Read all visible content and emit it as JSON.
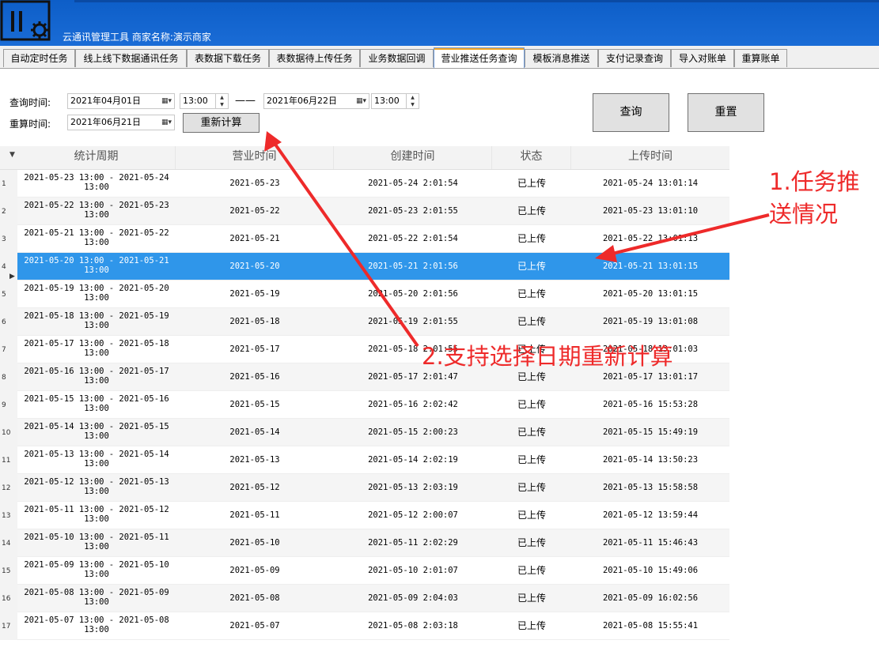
{
  "app": {
    "title": "云通讯管理工具  商家名称:演示商家"
  },
  "tabs": [
    {
      "label": "自动定时任务"
    },
    {
      "label": "线上线下数据通讯任务"
    },
    {
      "label": "表数据下载任务"
    },
    {
      "label": "表数据待上传任务"
    },
    {
      "label": "业务数据回调"
    },
    {
      "label": "营业推送任务查询"
    },
    {
      "label": "模板消息推送"
    },
    {
      "label": "支付记录查询"
    },
    {
      "label": "导入对账单"
    },
    {
      "label": "重算账单"
    }
  ],
  "active_tab": "营业推送任务查询",
  "filters": {
    "query_label": "查询时间:",
    "start_date": "2021年04月01日",
    "start_time": "13:00",
    "separator": "——",
    "end_date": "2021年06月22日",
    "end_time": "13:00",
    "recalc_label": "重算时间:",
    "recalc_date": "2021年06月21日",
    "recalc_button": "重新计算",
    "query_button": "查询",
    "reset_button": "重置"
  },
  "table": {
    "columns": [
      "统计周期",
      "营业时间",
      "创建时间",
      "状态",
      "上传时间"
    ],
    "selected_row": 4,
    "rows": [
      {
        "num": "1",
        "period_a": "2021-05-23 13:00 - 2021-05-24",
        "period_b": "13:00",
        "business": "2021-05-23",
        "created": "2021-05-24 2:01:54",
        "status": "已上传",
        "uploaded": "2021-05-24 13:01:14"
      },
      {
        "num": "2",
        "period_a": "2021-05-22 13:00 - 2021-05-23",
        "period_b": "13:00",
        "business": "2021-05-22",
        "created": "2021-05-23 2:01:55",
        "status": "已上传",
        "uploaded": "2021-05-23 13:01:10"
      },
      {
        "num": "3",
        "period_a": "2021-05-21 13:00 - 2021-05-22",
        "period_b": "13:00",
        "business": "2021-05-21",
        "created": "2021-05-22 2:01:54",
        "status": "已上传",
        "uploaded": "2021-05-22 13:01:13"
      },
      {
        "num": "4",
        "period_a": "2021-05-20 13:00 - 2021-05-21",
        "period_b": "13:00",
        "business": "2021-05-20",
        "created": "2021-05-21 2:01:56",
        "status": "已上传",
        "uploaded": "2021-05-21 13:01:15"
      },
      {
        "num": "5",
        "period_a": "2021-05-19 13:00 - 2021-05-20",
        "period_b": "13:00",
        "business": "2021-05-19",
        "created": "2021-05-20 2:01:56",
        "status": "已上传",
        "uploaded": "2021-05-20 13:01:15"
      },
      {
        "num": "6",
        "period_a": "2021-05-18 13:00 - 2021-05-19",
        "period_b": "13:00",
        "business": "2021-05-18",
        "created": "2021-05-19 2:01:55",
        "status": "已上传",
        "uploaded": "2021-05-19 13:01:08"
      },
      {
        "num": "7",
        "period_a": "2021-05-17 13:00 - 2021-05-18",
        "period_b": "13:00",
        "business": "2021-05-17",
        "created": "2021-05-18 2:01:55",
        "status": "已上传",
        "uploaded": "2021-05-18 13:01:03"
      },
      {
        "num": "8",
        "period_a": "2021-05-16 13:00 - 2021-05-17",
        "period_b": "13:00",
        "business": "2021-05-16",
        "created": "2021-05-17 2:01:47",
        "status": "已上传",
        "uploaded": "2021-05-17 13:01:17"
      },
      {
        "num": "9",
        "period_a": "2021-05-15 13:00 - 2021-05-16",
        "period_b": "13:00",
        "business": "2021-05-15",
        "created": "2021-05-16 2:02:42",
        "status": "已上传",
        "uploaded": "2021-05-16 15:53:28"
      },
      {
        "num": "10",
        "period_a": "2021-05-14 13:00 - 2021-05-15",
        "period_b": "13:00",
        "business": "2021-05-14",
        "created": "2021-05-15 2:00:23",
        "status": "已上传",
        "uploaded": "2021-05-15 15:49:19"
      },
      {
        "num": "11",
        "period_a": "2021-05-13 13:00 - 2021-05-14",
        "period_b": "13:00",
        "business": "2021-05-13",
        "created": "2021-05-14 2:02:19",
        "status": "已上传",
        "uploaded": "2021-05-14 13:50:23"
      },
      {
        "num": "12",
        "period_a": "2021-05-12 13:00 - 2021-05-13",
        "period_b": "13:00",
        "business": "2021-05-12",
        "created": "2021-05-13 2:03:19",
        "status": "已上传",
        "uploaded": "2021-05-13 15:58:58"
      },
      {
        "num": "13",
        "period_a": "2021-05-11 13:00 - 2021-05-12",
        "period_b": "13:00",
        "business": "2021-05-11",
        "created": "2021-05-12 2:00:07",
        "status": "已上传",
        "uploaded": "2021-05-12 13:59:44"
      },
      {
        "num": "14",
        "period_a": "2021-05-10 13:00 - 2021-05-11",
        "period_b": "13:00",
        "business": "2021-05-10",
        "created": "2021-05-11 2:02:29",
        "status": "已上传",
        "uploaded": "2021-05-11 15:46:43"
      },
      {
        "num": "15",
        "period_a": "2021-05-09 13:00 - 2021-05-10",
        "period_b": "13:00",
        "business": "2021-05-09",
        "created": "2021-05-10 2:01:07",
        "status": "已上传",
        "uploaded": "2021-05-10 15:49:06"
      },
      {
        "num": "16",
        "period_a": "2021-05-08 13:00 - 2021-05-09",
        "period_b": "13:00",
        "business": "2021-05-08",
        "created": "2021-05-09 2:04:03",
        "status": "已上传",
        "uploaded": "2021-05-09 16:02:56"
      },
      {
        "num": "17",
        "period_a": "2021-05-07 13:00 - 2021-05-08",
        "period_b": "13:00",
        "business": "2021-05-07",
        "created": "2021-05-08 2:03:18",
        "status": "已上传",
        "uploaded": "2021-05-08 15:55:41"
      }
    ]
  },
  "annotations": {
    "note1_line1": "1.任务推",
    "note1_line2": "送情况",
    "note2": "2.支持选择日期重新计算"
  },
  "colors": {
    "header_blue": "#1565d0",
    "selection_blue": "#2f96ea",
    "annotation_red": "#ee2a2a"
  }
}
